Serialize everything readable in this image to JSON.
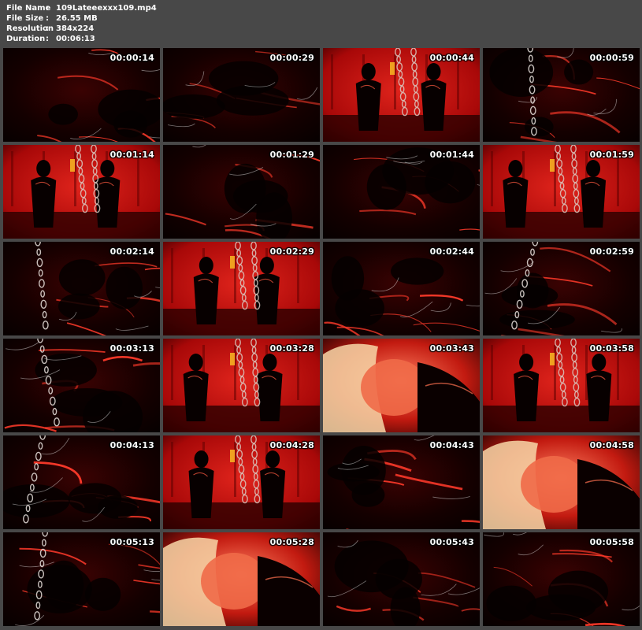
{
  "info": {
    "rows": [
      {
        "key": "File Name",
        "sep": ":",
        "value": "109Lateeexxx109.mp4"
      },
      {
        "key": "File Size",
        "sep": ":",
        "value": "26.55 MB"
      },
      {
        "key": "Resolution",
        "sep": ":",
        "value": "384x224"
      },
      {
        "key": "Duration",
        "sep": ":",
        "value": "00:06:13"
      }
    ]
  },
  "thumbnails": [
    {
      "time": "00:00:14",
      "scene": "dark-latex"
    },
    {
      "time": "00:00:29",
      "scene": "dark-latex"
    },
    {
      "time": "00:00:44",
      "scene": "red-room"
    },
    {
      "time": "00:00:59",
      "scene": "dark-chain"
    },
    {
      "time": "00:01:14",
      "scene": "red-room"
    },
    {
      "time": "00:01:29",
      "scene": "dark-latex"
    },
    {
      "time": "00:01:44",
      "scene": "dark-latex"
    },
    {
      "time": "00:01:59",
      "scene": "red-room"
    },
    {
      "time": "00:02:14",
      "scene": "dark-chain"
    },
    {
      "time": "00:02:29",
      "scene": "red-room"
    },
    {
      "time": "00:02:44",
      "scene": "dark-latex"
    },
    {
      "time": "00:02:59",
      "scene": "dark-chain"
    },
    {
      "time": "00:03:13",
      "scene": "dark-chain"
    },
    {
      "time": "00:03:28",
      "scene": "red-room"
    },
    {
      "time": "00:03:43",
      "scene": "face"
    },
    {
      "time": "00:03:58",
      "scene": "red-room"
    },
    {
      "time": "00:04:13",
      "scene": "dark-chain"
    },
    {
      "time": "00:04:28",
      "scene": "red-room"
    },
    {
      "time": "00:04:43",
      "scene": "dark-latex"
    },
    {
      "time": "00:04:58",
      "scene": "face"
    },
    {
      "time": "00:05:13",
      "scene": "dark-chain"
    },
    {
      "time": "00:05:28",
      "scene": "face"
    },
    {
      "time": "00:05:43",
      "scene": "dark-latex"
    },
    {
      "time": "00:05:58",
      "scene": "dark-latex"
    }
  ],
  "colors": {
    "background": "#484848",
    "text": "#ffffff",
    "red_wall": "#c40a0a",
    "deep_black": "#0a0000"
  }
}
